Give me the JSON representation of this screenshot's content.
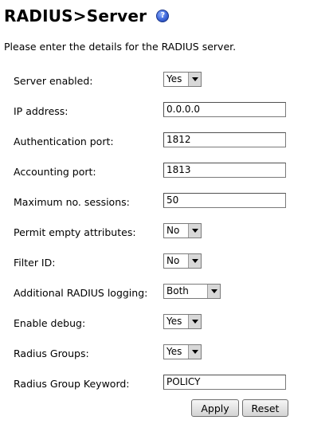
{
  "page": {
    "title": "RADIUS>Server",
    "help_icon": "help-icon",
    "intro": "Please enter the details for the RADIUS server."
  },
  "fields": {
    "server_enabled": {
      "label": "Server enabled:",
      "value": "Yes"
    },
    "ip_address": {
      "label": "IP address:",
      "value": "0.0.0.0"
    },
    "auth_port": {
      "label": "Authentication port:",
      "value": "1812"
    },
    "acct_port": {
      "label": "Accounting port:",
      "value": "1813"
    },
    "max_sessions": {
      "label": "Maximum no. sessions:",
      "value": "50"
    },
    "permit_empty": {
      "label": "Permit empty attributes:",
      "value": "No"
    },
    "filter_id": {
      "label": "Filter ID:",
      "value": "No"
    },
    "additional_logging": {
      "label": "Additional RADIUS logging:",
      "value": "Both"
    },
    "enable_debug": {
      "label": "Enable debug:",
      "value": "Yes"
    },
    "radius_groups": {
      "label": "Radius Groups:",
      "value": "Yes"
    },
    "group_keyword": {
      "label": "Radius Group Keyword:",
      "value": "POLICY"
    }
  },
  "buttons": {
    "apply": "Apply",
    "reset": "Reset"
  }
}
